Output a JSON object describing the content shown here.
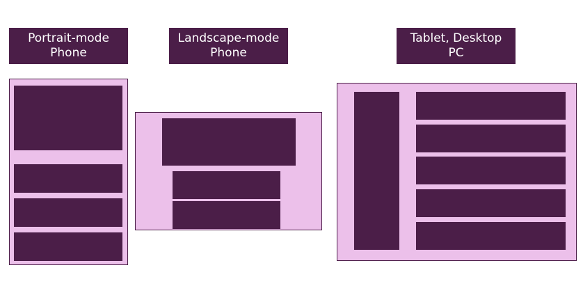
{
  "colors": {
    "dark": "#4b1e48",
    "light": "#ecc0ea",
    "background": "#ffffff",
    "label_text": "#ffffff"
  },
  "devices": [
    {
      "label_line1": "Portrait-mode",
      "label_line2": "Phone"
    },
    {
      "label_line1": "Landscape-mode",
      "label_line2": "Phone"
    },
    {
      "label_line1": "Tablet, Desktop",
      "label_line2": "PC"
    }
  ]
}
